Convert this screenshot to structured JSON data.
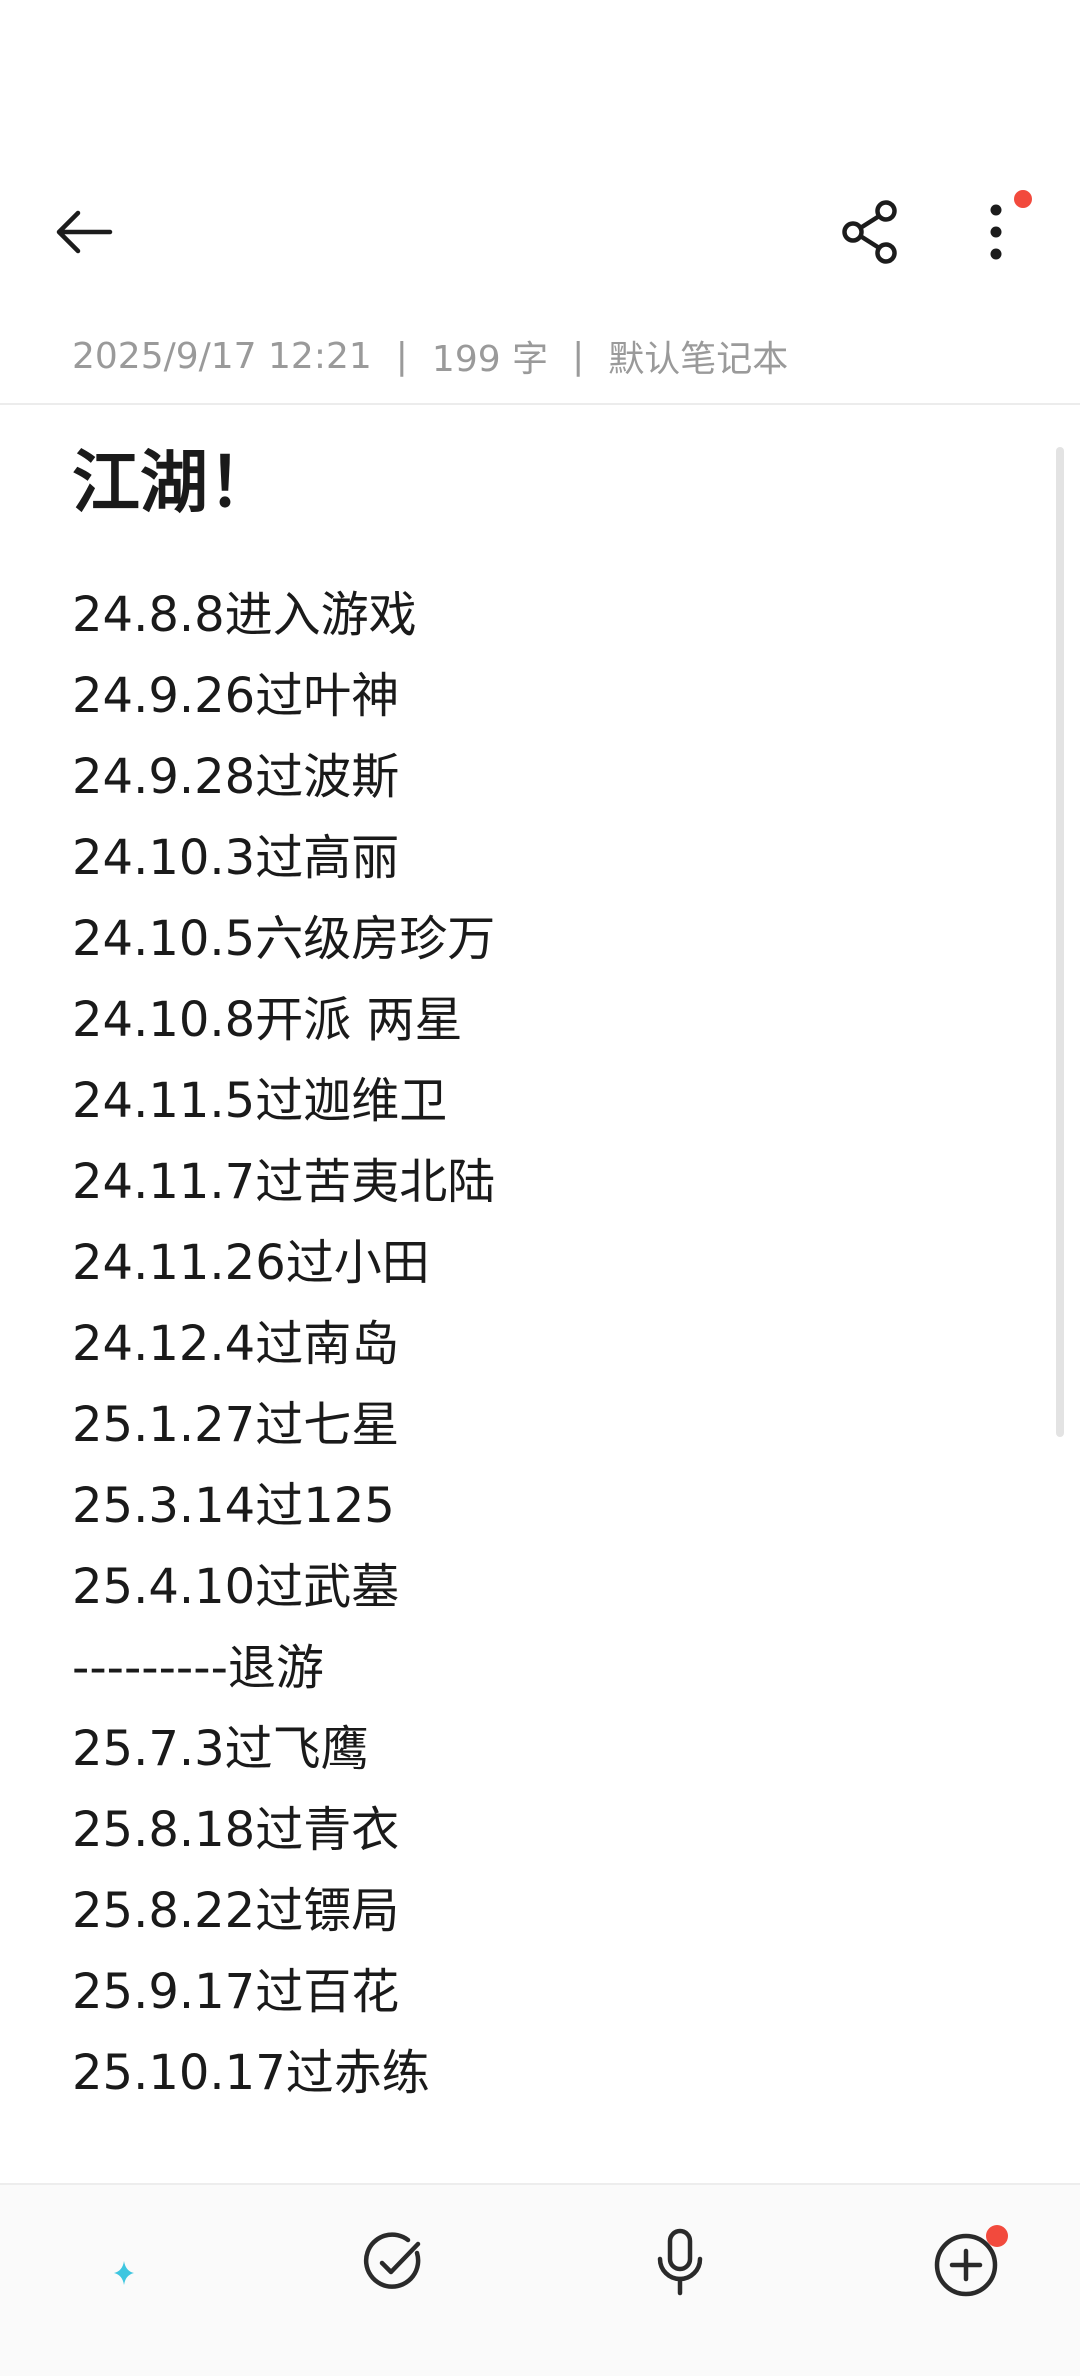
{
  "header": {
    "back_icon": "arrow-left-icon",
    "share_icon": "share-icon",
    "more_icon": "more-vertical-icon",
    "notification_dot_color": "#f24a3d"
  },
  "meta": {
    "datetime": "2025/9/17 12:21",
    "separator": "|",
    "word_count": "199 字",
    "notebook": "默认笔记本"
  },
  "note": {
    "title": "江湖！",
    "lines": [
      "24.8.8进入游戏",
      "24.9.26过叶神",
      "24.9.28过波斯",
      "24.10.3过高丽",
      "24.10.5六级房珍万",
      "24.10.8开派 两星",
      "24.11.5过迦维卫",
      "24.11.7过苦夷北陆",
      "24.11.26过小田",
      "24.12.4过南岛",
      "25.1.27过七星",
      "25.3.14过125",
      "25.4.10过武墓",
      "---------退游",
      "25.7.3过飞鹰",
      "25.8.18过青衣",
      "25.8.22过镖局",
      "25.9.17过百花",
      "25.10.17过赤练"
    ]
  },
  "toolbar": {
    "items": [
      "ai-format-icon",
      "checklist-icon",
      "microphone-icon",
      "add-circle-icon"
    ],
    "colors": {
      "ai_gradient": [
        "#f5a623",
        "#e0559c",
        "#7b61ff",
        "#3ec6e0"
      ],
      "icon": "#2a2a2a"
    }
  }
}
